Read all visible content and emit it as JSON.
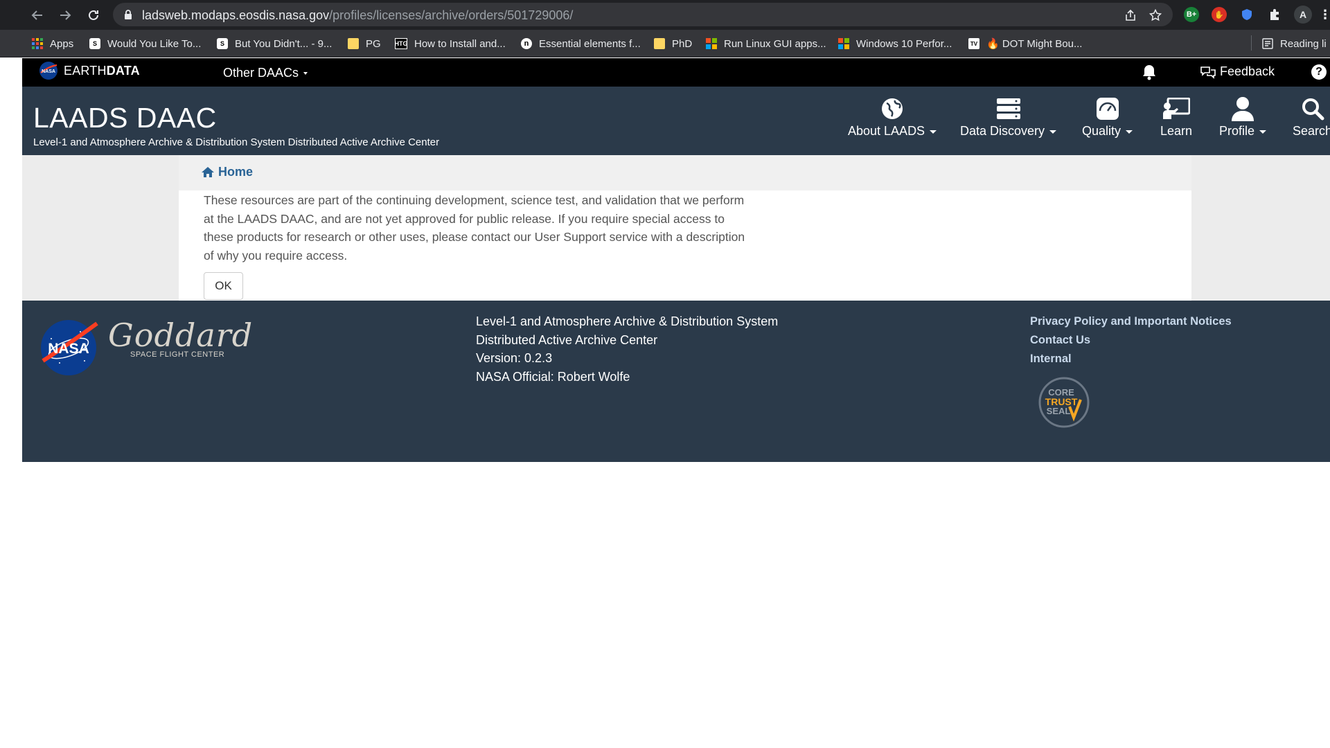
{
  "browser": {
    "url_host": "ladsweb.modaps.eosdis.nasa.gov",
    "url_path": "/profiles/licenses/archive/orders/501729006/",
    "profile_initial": "A",
    "ext_badge": "B+",
    "bookmarks": [
      {
        "label": "Apps",
        "icon": "apps-grid-icon"
      },
      {
        "label": "Would You Like To...",
        "icon": "bookmark-favicon"
      },
      {
        "label": "But You Didn't... - 9...",
        "icon": "bookmark-favicon"
      },
      {
        "label": "PG",
        "icon": "folder-icon"
      },
      {
        "label": "How to Install and...",
        "icon": "htg-favicon"
      },
      {
        "label": "Essential elements f...",
        "icon": "bookmark-favicon"
      },
      {
        "label": "PhD",
        "icon": "folder-icon"
      },
      {
        "label": "Run Linux GUI apps...",
        "icon": "microsoft-icon"
      },
      {
        "label": "Windows 10 Perfor...",
        "icon": "microsoft-icon"
      },
      {
        "label": "🔥 DOT Might Bou...",
        "icon": "bookmark-favicon"
      }
    ],
    "reading_list": "Reading li"
  },
  "earthbar": {
    "brand_light": "EARTH",
    "brand_bold": "DATA",
    "other_daacs": "Other DAACs",
    "feedback": "Feedback",
    "help": "?"
  },
  "header": {
    "title": "LAADS DAAC",
    "subtitle": "Level-1 and Atmosphere Archive & Distribution System Distributed Active Archive Center",
    "nav": [
      {
        "label": "About LAADS",
        "icon": "globe-icon",
        "dropdown": true
      },
      {
        "label": "Data Discovery",
        "icon": "server-stack-icon",
        "dropdown": true
      },
      {
        "label": "Quality",
        "icon": "gauge-icon",
        "dropdown": true
      },
      {
        "label": "Learn",
        "icon": "presentation-icon",
        "dropdown": false
      },
      {
        "label": "Profile",
        "icon": "user-icon",
        "dropdown": true
      },
      {
        "label": "Search",
        "icon": "search-icon",
        "dropdown": false
      }
    ]
  },
  "main": {
    "breadcrumb_home": "Home",
    "notice": "These resources are part of the continuing development, science test, and validation that we perform at the LAADS DAAC, and are not yet approved for public release. If you require special access to these products for research or other uses, please contact our User Support service with a description of why you require access.",
    "ok_label": "OK"
  },
  "footer": {
    "nasa_logo_text": "NASA",
    "goddard_script": "Goddard",
    "goddard_sub": "SPACE FLIGHT CENTER",
    "lines": [
      "Level-1 and Atmosphere Archive & Distribution System",
      "Distributed Active Archive Center",
      "Version: 0.2.3",
      "NASA Official: Robert Wolfe"
    ],
    "links": [
      "Privacy Policy and Important Notices",
      "Contact Us",
      "Internal"
    ],
    "seal_text": [
      "CORE",
      "TRUST",
      "SEAL"
    ]
  },
  "colors": {
    "header_bg": "#2b3a4a",
    "link_blue": "#2a6496",
    "earthbar_bg": "#000000"
  }
}
